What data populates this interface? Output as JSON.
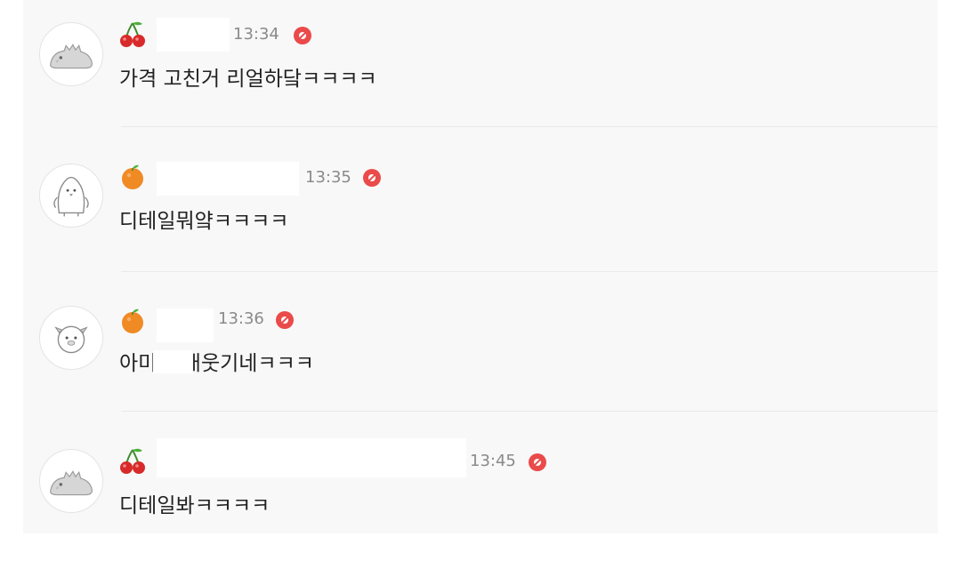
{
  "messages": [
    {
      "badge_icon": "cherry-icon",
      "avatar_icon": "dinosaur-avatar-icon",
      "time": "13:34",
      "text": "가격 고친거 리얼하닼ㅋㅋㅋㅋ"
    },
    {
      "badge_icon": "orange-icon",
      "avatar_icon": "penguin-avatar-icon",
      "time": "13:35",
      "text": "디테일뭐얔ㅋㅋㅋㅋ"
    },
    {
      "badge_icon": "orange-icon",
      "avatar_icon": "face-avatar-icon",
      "time": "13:36",
      "text": "아미치 개웃기네ㅋㅋㅋ"
    },
    {
      "badge_icon": "cherry-icon",
      "avatar_icon": "dinosaur-avatar-icon",
      "time": "13:45",
      "text": "디테일봐ㅋㅋㅋㅋ"
    }
  ],
  "colors": {
    "background": "#f8f8f8",
    "text": "#222222",
    "timestamp": "#8a8a8a",
    "block_icon": "#ea4a4a"
  }
}
